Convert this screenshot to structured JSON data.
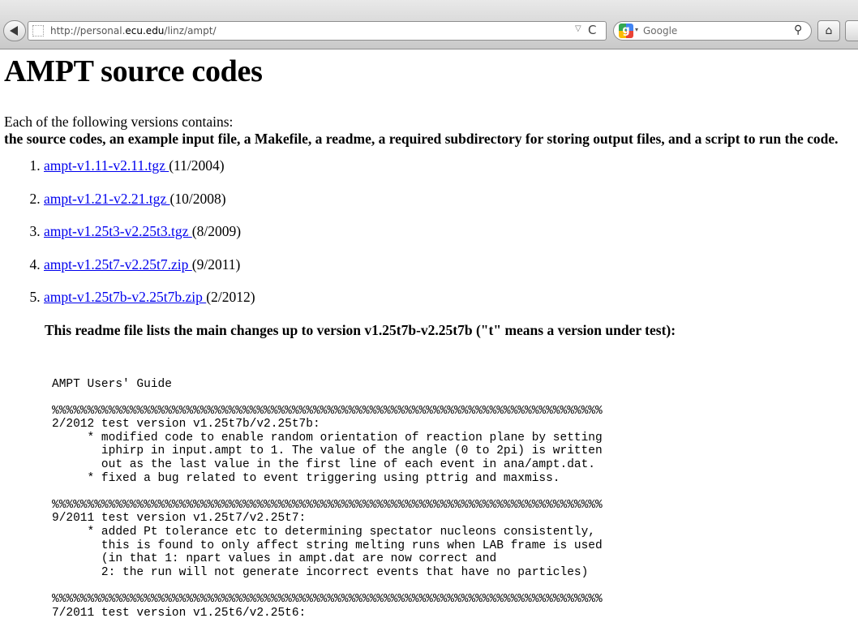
{
  "browser": {
    "url_prefix": "http://personal.",
    "url_host": "ecu.edu",
    "url_path": "/linz/ampt/",
    "url_dropdown_glyph": "▽",
    "reload_glyph": "C",
    "search_engine_glyph": "g",
    "search_dropdown_glyph": "▾",
    "search_placeholder": "Google",
    "search_glyph": "⚲",
    "home_glyph": "⌂",
    "icons": [
      "back-arrow-icon",
      "site-identity-icon",
      "reload-icon",
      "google-icon",
      "search-icon",
      "home-icon"
    ]
  },
  "page": {
    "title": "AMPT source codes",
    "intro": "Each of the following versions contains:",
    "intro_bold": "the source codes, an example input file, a Makefile, a readme, a required subdirectory for storing output files, and a script to run the code.",
    "versions": [
      {
        "link": "ampt-v1.11-v2.11.tgz ",
        "date": "(11/2004)"
      },
      {
        "link": "ampt-v1.21-v2.21.tgz ",
        "date": "(10/2008)"
      },
      {
        "link": "ampt-v1.25t3-v2.25t3.tgz ",
        "date": "(8/2009)"
      },
      {
        "link": "ampt-v1.25t7-v2.25t7.zip ",
        "date": "(9/2011)"
      },
      {
        "link": "ampt-v1.25t7b-v2.25t7b.zip ",
        "date": "(2/2012)"
      }
    ],
    "readme_note": "This readme file lists the main changes up to version v1.25t7b-v2.25t7b (\"t\" means a version under test):",
    "guide_title": "AMPT Users' Guide",
    "guide_divider": "%%%%%%%%%%%%%%%%%%%%%%%%%%%%%%%%%%%%%%%%%%%%%%%%%%%%%%%%%%%%%%%%%%%%%%%%%%%%%%",
    "guide_sections": [
      {
        "header": "2/2012 test version v1.25t7b/v2.25t7b:",
        "body": "     * modified code to enable random orientation of reaction plane by setting\n       iphirp in input.ampt to 1. The value of the angle (0 to 2pi) is written\n       out as the last value in the first line of each event in ana/ampt.dat.\n     * fixed a bug related to event triggering using pttrig and maxmiss."
      },
      {
        "header": "9/2011 test version v1.25t7/v2.25t7:",
        "body": "     * added Pt tolerance etc to determining spectator nucleons consistently,\n       this is found to only affect string melting runs when LAB frame is used\n       (in that 1: npart values in ampt.dat are now correct and\n       2: the run will not generate incorrect events that have no particles)"
      }
    ],
    "guide_cutoff_line": "7/2011 test version v1.25t6/v2.25t6:"
  }
}
